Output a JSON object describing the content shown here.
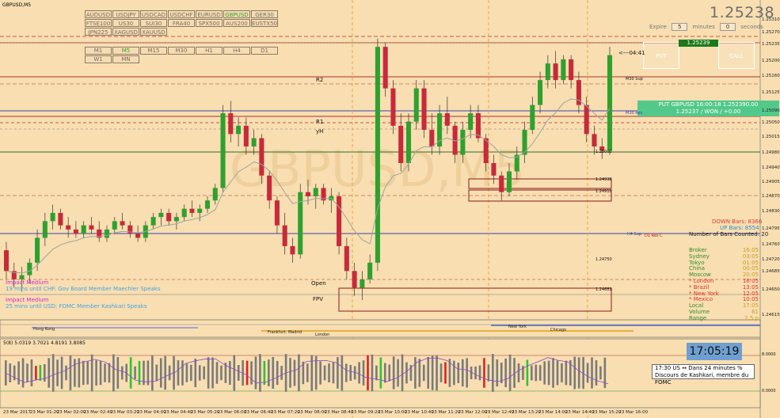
{
  "window": {
    "title": "GBPUSD,M5"
  },
  "watermark": "GBPUSD,M5",
  "symbols": [
    [
      "AUDUSD",
      "USDJPY",
      "USDCAD",
      "USDCHF",
      "EURUSD",
      "GBPUSD",
      "GER30"
    ],
    [
      "FTSE100",
      "US30",
      "SUI30",
      "FRA40",
      "SPX500",
      "AUS200",
      "EUSTX50"
    ],
    [
      "JPN225",
      "XAGUSD",
      "XAUUSD"
    ]
  ],
  "active_symbol": "GBPUSD",
  "timeframes": [
    [
      "M1",
      "M5",
      "M15",
      "M30",
      "H1",
      "H4",
      "D1"
    ],
    [
      "W1",
      "MN"
    ]
  ],
  "active_timeframe": "M5",
  "price_display": "1.25238",
  "expiry": {
    "label": "Expire",
    "minutes_value": "5",
    "minutes_label": "minutes",
    "seconds_value": "0",
    "seconds_label": "seconds"
  },
  "buttons": {
    "put": "PUT",
    "call": "CALL"
  },
  "current_price_tag": "1.25239",
  "countdown": "<---04:41",
  "trade_result": {
    "line1": "PUT GBPUSD 16:00:18 1.252390.00",
    "line2": "1.25237 / WON / +0.00"
  },
  "levels": {
    "r2": "R2",
    "r1": "R1",
    "yh": "yH",
    "open": "Open",
    "fpv": "FPV",
    "m30sup": "M30 Sup",
    "m30res": "M30 Res",
    "hsup": "H4 Sup",
    "d1res": "D1 Res C",
    "box1": "1.24938",
    "box2": "1.24910",
    "lvl1": "1.25000",
    "lvl2": "1.24750",
    "lvl3": "1.24681"
  },
  "stats": {
    "down_bars": "DOWN Bars: 8366",
    "up_bars": "UP Bars: 8554",
    "bars_counted": "Number of Bars Counted: 20",
    "rows": [
      {
        "k": "Broker",
        "v": "16:05"
      },
      {
        "k": "Sydney",
        "v": "03:05"
      },
      {
        "k": "Tokyo",
        "v": "01:05"
      },
      {
        "k": "China",
        "v": "00:05"
      },
      {
        "k": "Moscow",
        "v": "20:05"
      },
      {
        "k": "* London",
        "v": "16:05"
      },
      {
        "k": "* Brazil",
        "v": "13:05"
      },
      {
        "k": "* New York",
        "v": "12:05"
      },
      {
        "k": "* Mexico",
        "v": "10:05"
      },
      {
        "k": "Local",
        "v": "17:05"
      },
      {
        "k": "Volume",
        "v": "61"
      },
      {
        "k": "Range",
        "v": "2.5 p"
      }
    ]
  },
  "news": [
    {
      "title": "Impact Medium",
      "detail": "19 mins until CHF: Gov Board Member Maechler Speaks"
    },
    {
      "title": "Impact Medium",
      "detail": "25 mins until USD: FOMC Member Kashkari Speaks"
    }
  ],
  "sessions": {
    "hongkong": "Hong Kong",
    "frankfurt": "Frankfurt, Madrid",
    "london": "London",
    "newyork": "New York",
    "chicago": "Chicago"
  },
  "oscillator_label": "5(8) 5.0319 3.7021 4.8191 3.8085",
  "osc_axis": [
    "8.0000",
    "0.0000"
  ],
  "clock": "17:05:19",
  "news_tooltip": {
    "line1": "17:30  US  ↔  Dans 24 minutes  %",
    "line2": "Discours de Kashkari, membre du FOMC"
  },
  "colors": {
    "bull": "#2ea12e",
    "bear": "#c72a3a",
    "background": "#f8deb1",
    "ema": "#9ea59e"
  },
  "chart_data": {
    "type": "candlestick",
    "symbol": "GBPUSD",
    "timeframe": "M5",
    "ylim": [
      1.2461,
      1.2535
    ],
    "y_ticks": [
      "1.25310",
      "1.25270",
      "1.25235",
      "1.25200",
      "1.25160",
      "1.25125",
      "1.25090",
      "1.25050",
      "1.25015",
      "1.24980",
      "1.24940",
      "1.24905",
      "1.24870",
      "1.24830",
      "1.24795",
      "1.24760",
      "1.24720",
      "1.24685",
      "1.24650",
      "1.24615"
    ],
    "x_ticks": [
      "23 Mar 2017",
      "23 Mar 01:20",
      "23 Mar 02:00",
      "23 Mar 02:40",
      "23 Mar 03:20",
      "23 Mar 04:00",
      "23 Mar 04:40",
      "23 Mar 05:20",
      "23 Mar 06:00",
      "23 Mar 06:40",
      "23 Mar 07:20",
      "23 Mar 08:00",
      "23 Mar 08:40",
      "23 Mar 09:20",
      "23 Mar 10:00",
      "23 Mar 10:40",
      "23 Mar 11:20",
      "23 Mar 12:00",
      "23 Mar 12:40",
      "23 Mar 13:20",
      "23 Mar 14:00",
      "23 Mar 14:40",
      "23 Mar 15:20",
      "23 Mar 16:00"
    ],
    "candles": [
      [
        1.2477,
        1.2479,
        1.247,
        1.2472
      ],
      [
        1.2472,
        1.2474,
        1.2468,
        1.247
      ],
      [
        1.247,
        1.2473,
        1.2467,
        1.2471
      ],
      [
        1.2471,
        1.2475,
        1.2469,
        1.2474
      ],
      [
        1.2474,
        1.2482,
        1.2472,
        1.248
      ],
      [
        1.248,
        1.2486,
        1.2478,
        1.2484
      ],
      [
        1.2484,
        1.2488,
        1.2482,
        1.2486
      ],
      [
        1.2486,
        1.2487,
        1.2482,
        1.2483
      ],
      [
        1.2483,
        1.2485,
        1.248,
        1.2482
      ],
      [
        1.2482,
        1.2484,
        1.248,
        1.2481
      ],
      [
        1.2481,
        1.2484,
        1.248,
        1.2483
      ],
      [
        1.2483,
        1.2485,
        1.2481,
        1.2482
      ],
      [
        1.2482,
        1.2484,
        1.2479,
        1.248
      ],
      [
        1.248,
        1.2483,
        1.2479,
        1.2482
      ],
      [
        1.2482,
        1.2485,
        1.2481,
        1.2484
      ],
      [
        1.2484,
        1.2486,
        1.2482,
        1.2483
      ],
      [
        1.2483,
        1.2484,
        1.248,
        1.2481
      ],
      [
        1.2481,
        1.2483,
        1.2479,
        1.248
      ],
      [
        1.248,
        1.2484,
        1.2479,
        1.2483
      ],
      [
        1.2483,
        1.2486,
        1.2482,
        1.2485
      ],
      [
        1.2485,
        1.2487,
        1.2483,
        1.2486
      ],
      [
        1.2486,
        1.2487,
        1.2483,
        1.2484
      ],
      [
        1.2484,
        1.2486,
        1.2482,
        1.2485
      ],
      [
        1.2485,
        1.2488,
        1.2484,
        1.2487
      ],
      [
        1.2487,
        1.2489,
        1.2485,
        1.2486
      ],
      [
        1.2486,
        1.2488,
        1.2484,
        1.2487
      ],
      [
        1.2487,
        1.249,
        1.2486,
        1.2489
      ],
      [
        1.2489,
        1.2493,
        1.2488,
        1.2492
      ],
      [
        1.2492,
        1.2512,
        1.2491,
        1.251
      ],
      [
        1.251,
        1.2513,
        1.2503,
        1.2505
      ],
      [
        1.2505,
        1.2509,
        1.2502,
        1.2507
      ],
      [
        1.2507,
        1.2509,
        1.25,
        1.2502
      ],
      [
        1.2502,
        1.2506,
        1.25,
        1.2504
      ],
      [
        1.2504,
        1.2505,
        1.2493,
        1.2495
      ],
      [
        1.2495,
        1.2496,
        1.2487,
        1.2489
      ],
      [
        1.2489,
        1.249,
        1.2481,
        1.2483
      ],
      [
        1.2483,
        1.2486,
        1.2476,
        1.2478
      ],
      [
        1.2478,
        1.248,
        1.2474,
        1.2476
      ],
      [
        1.2476,
        1.2493,
        1.2475,
        1.2491
      ],
      [
        1.2491,
        1.2494,
        1.2488,
        1.249
      ],
      [
        1.249,
        1.2493,
        1.2487,
        1.2492
      ],
      [
        1.2492,
        1.2493,
        1.2488,
        1.2489
      ],
      [
        1.2489,
        1.2492,
        1.2486,
        1.249
      ],
      [
        1.249,
        1.2491,
        1.2476,
        1.2478
      ],
      [
        1.2478,
        1.248,
        1.247,
        1.2472
      ],
      [
        1.2472,
        1.2474,
        1.2466,
        1.2468
      ],
      [
        1.2468,
        1.2472,
        1.2465,
        1.247
      ],
      [
        1.247,
        1.2476,
        1.2469,
        1.2474
      ],
      [
        1.2474,
        1.2528,
        1.2472,
        1.2526
      ],
      [
        1.2526,
        1.2527,
        1.2514,
        1.2516
      ],
      [
        1.2516,
        1.2518,
        1.2505,
        1.2507
      ],
      [
        1.2507,
        1.251,
        1.2496,
        1.2498
      ],
      [
        1.2498,
        1.251,
        1.2496,
        1.2508
      ],
      [
        1.2508,
        1.2518,
        1.2506,
        1.2516
      ],
      [
        1.2516,
        1.2518,
        1.2504,
        1.2506
      ],
      [
        1.2506,
        1.251,
        1.25,
        1.2502
      ],
      [
        1.2502,
        1.2512,
        1.25,
        1.251
      ],
      [
        1.251,
        1.2514,
        1.2505,
        1.2507
      ],
      [
        1.2507,
        1.2508,
        1.2498,
        1.25
      ],
      [
        1.25,
        1.2508,
        1.2498,
        1.2506
      ],
      [
        1.2506,
        1.2512,
        1.2504,
        1.251
      ],
      [
        1.251,
        1.2512,
        1.2503,
        1.2504
      ],
      [
        1.2504,
        1.2505,
        1.2496,
        1.2498
      ],
      [
        1.2498,
        1.25,
        1.2493,
        1.2495
      ],
      [
        1.2495,
        1.2496,
        1.2489,
        1.2491
      ],
      [
        1.2491,
        1.2498,
        1.249,
        1.2496
      ],
      [
        1.2496,
        1.2502,
        1.2494,
        1.25
      ],
      [
        1.25,
        1.2508,
        1.2498,
        1.2506
      ],
      [
        1.2506,
        1.2514,
        1.2505,
        1.2512
      ],
      [
        1.2512,
        1.252,
        1.251,
        1.2518
      ],
      [
        1.2518,
        1.2524,
        1.2516,
        1.2522
      ],
      [
        1.2522,
        1.2525,
        1.2516,
        1.2518
      ],
      [
        1.2518,
        1.2524,
        1.2517,
        1.2523
      ],
      [
        1.2523,
        1.2524,
        1.2516,
        1.2518
      ],
      [
        1.2518,
        1.252,
        1.251,
        1.2512
      ],
      [
        1.2512,
        1.2514,
        1.2503,
        1.2505
      ],
      [
        1.2505,
        1.2507,
        1.25,
        1.2502
      ],
      [
        1.2502,
        1.2504,
        1.2499,
        1.2501
      ],
      [
        1.2501,
        1.2526,
        1.25,
        1.2524
      ]
    ]
  }
}
